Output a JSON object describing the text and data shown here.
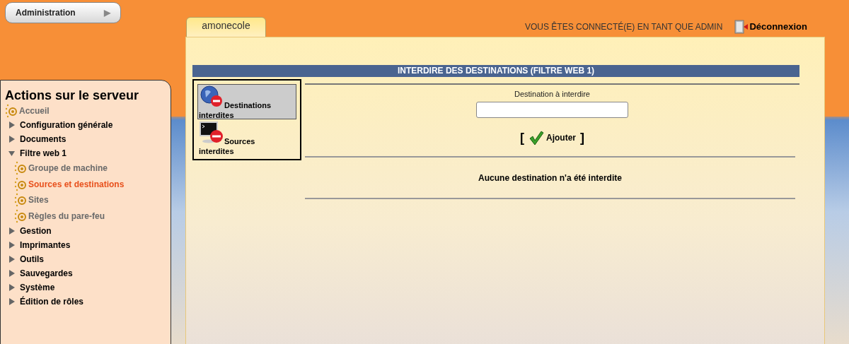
{
  "top_button": {
    "label": "Administration",
    "arrow": "▶"
  },
  "server_tab": {
    "label": "amonecole"
  },
  "user_status": "VOUS ÊTES CONNECTÉ(E) EN TANT QUE ADMIN",
  "logout": {
    "label": "Déconnexion"
  },
  "sidebar": {
    "title": "Actions sur le serveur",
    "items": [
      {
        "kind": "page",
        "label": "Accueil",
        "selected": false
      },
      {
        "kind": "group",
        "label": "Configuration générale",
        "expanded": false
      },
      {
        "kind": "group",
        "label": "Documents",
        "expanded": false
      },
      {
        "kind": "group",
        "label": "Filtre web 1",
        "expanded": true,
        "children": [
          {
            "kind": "page",
            "label": "Groupe de machine",
            "selected": false
          },
          {
            "kind": "page",
            "label": "Sources et destinations",
            "selected": true
          },
          {
            "kind": "page",
            "label": "Sites",
            "selected": false
          },
          {
            "kind": "page",
            "label": "Règles du pare-feu",
            "selected": false
          }
        ]
      },
      {
        "kind": "group",
        "label": "Gestion",
        "expanded": false
      },
      {
        "kind": "group",
        "label": "Imprimantes",
        "expanded": false
      },
      {
        "kind": "group",
        "label": "Outils",
        "expanded": false
      },
      {
        "kind": "group",
        "label": "Sauvegardes",
        "expanded": false
      },
      {
        "kind": "group",
        "label": "Système",
        "expanded": false
      },
      {
        "kind": "group",
        "label": "Édition de rôles",
        "expanded": false
      }
    ]
  },
  "section_title": "INTERDIRE DES DESTINATIONS (FILTRE WEB 1)",
  "subnav": [
    {
      "kind": "globe",
      "label": "Destinations interdites",
      "selected": true
    },
    {
      "kind": "monitor",
      "label": "Sources interdites",
      "selected": false
    }
  ],
  "form": {
    "field_label": "Destination à interdire",
    "open_bracket": "[",
    "button": "Ajouter",
    "close_bracket": "]"
  },
  "empty_message": "Aucune destination n'a été interdite"
}
